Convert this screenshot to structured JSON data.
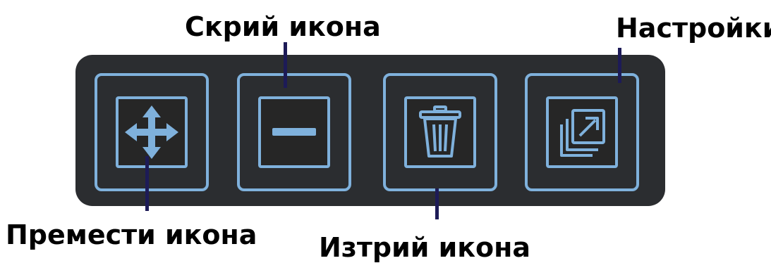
{
  "toolbar": {
    "buttons": [
      {
        "id": "move",
        "icon": "move-arrows-icon",
        "callout": "Премести икона"
      },
      {
        "id": "hide",
        "icon": "minus-icon",
        "callout": "Скрий икона"
      },
      {
        "id": "delete",
        "icon": "trash-icon",
        "callout": "Изтрий икона"
      },
      {
        "id": "settings",
        "icon": "open-external-icon",
        "callout": "Настройки"
      }
    ]
  },
  "colors": {
    "panel": "#2b2d30",
    "accent": "#7fb1dc",
    "leader_line": "#1d1b57",
    "label_text": "#000000"
  }
}
